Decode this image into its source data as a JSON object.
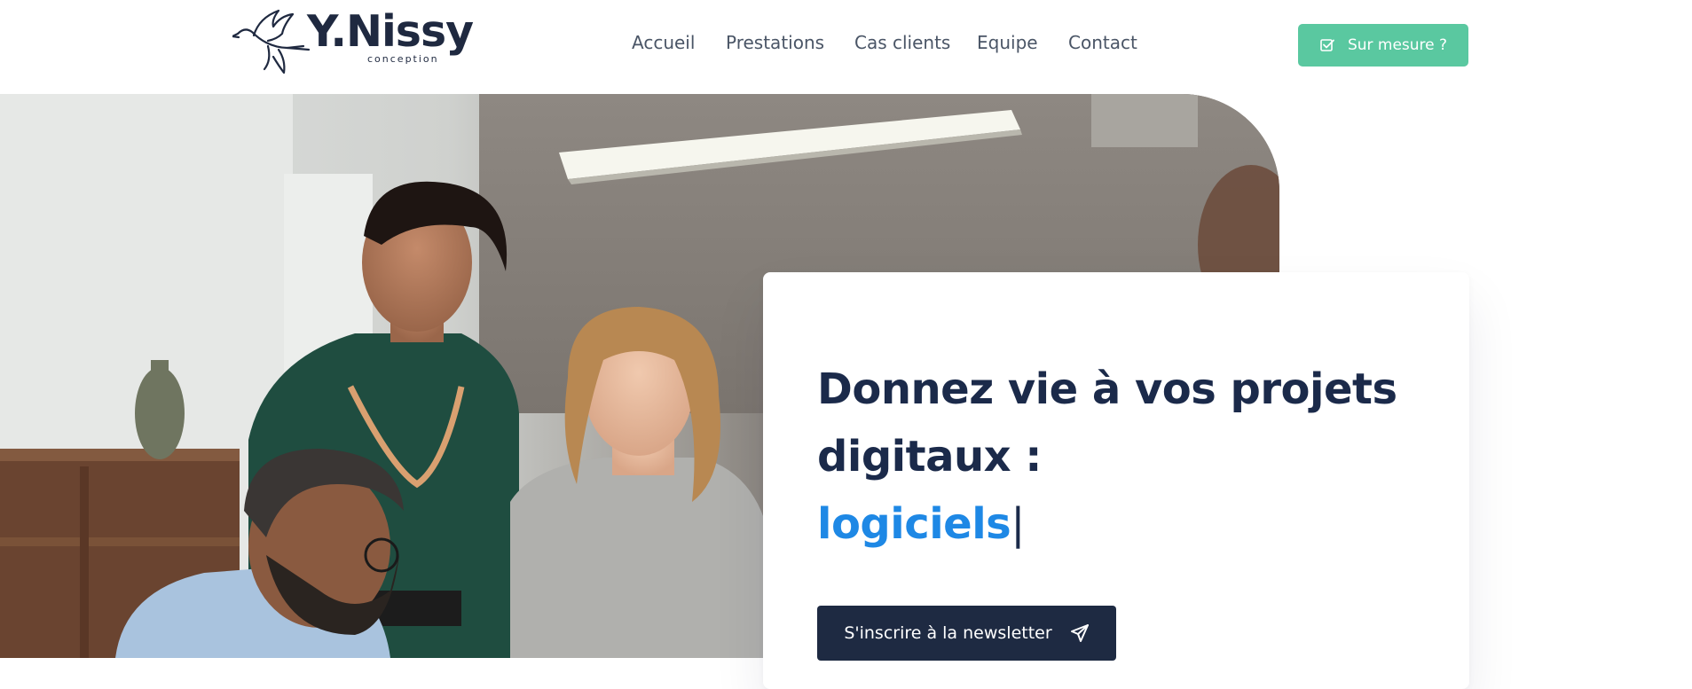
{
  "brand": {
    "name": "Y.Nissy",
    "tagline": "conception"
  },
  "nav": {
    "items": [
      {
        "label": "Accueil"
      },
      {
        "label": "Prestations"
      },
      {
        "label": "Cas clients"
      },
      {
        "label": "Equipe"
      },
      {
        "label": "Contact"
      }
    ]
  },
  "cta": {
    "label": "Sur mesure ?",
    "icon": "checkbox-icon",
    "color": "#5ac8a0"
  },
  "hero": {
    "headline_line1": "Donnez vie à vos projets",
    "headline_line2": "digitaux :",
    "typed_word": "logiciels",
    "cursor": "|",
    "accent_color": "#1e88e5",
    "newsletter_label": "S'inscrire à la newsletter",
    "newsletter_icon": "paper-plane-icon"
  }
}
